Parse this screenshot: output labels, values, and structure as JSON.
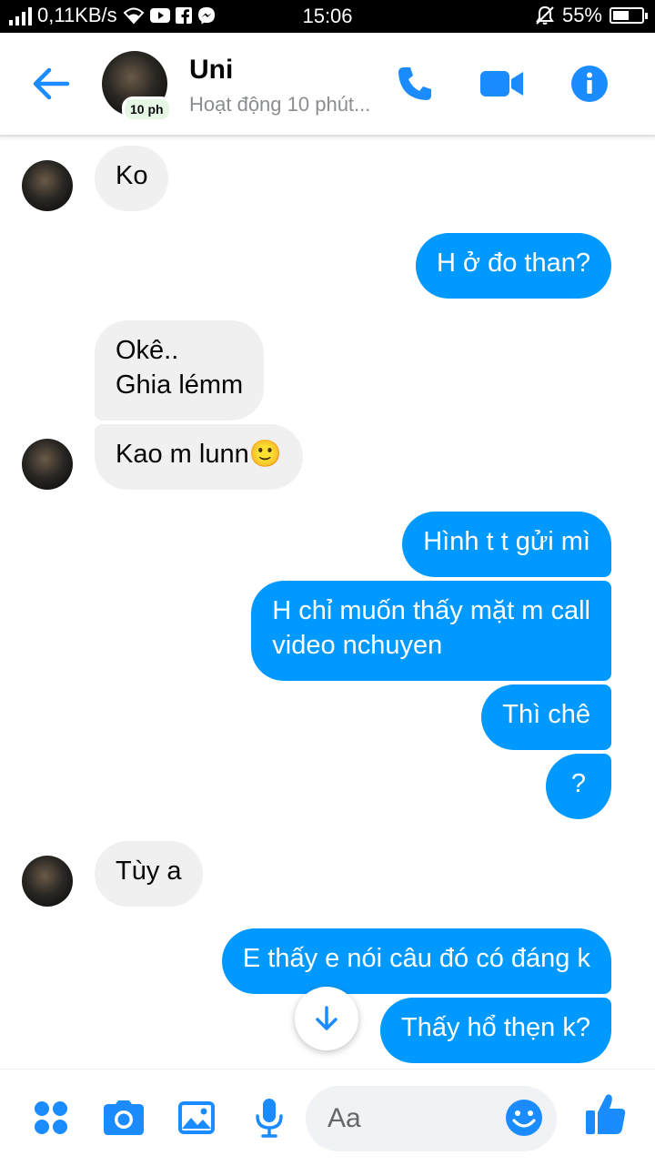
{
  "status_bar": {
    "speed": "0,11KB/s",
    "time": "15:06",
    "battery": "55%",
    "battery_level": 0.55
  },
  "header": {
    "name": "Uni",
    "status": "Hoạt động 10 phút...",
    "active_badge": "10 ph"
  },
  "messages": [
    {
      "side": "in",
      "text": "Ko"
    },
    {
      "side": "out",
      "text": "H ở đo than?"
    },
    {
      "side": "in",
      "text": "Okê..\nGhia lémm"
    },
    {
      "side": "in",
      "text": "Kao m lunn🙂"
    },
    {
      "side": "out",
      "text": "Hình t t gửi mì"
    },
    {
      "side": "out",
      "text": "H chỉ muốn thấy mặt m call\nvideo nchuyen"
    },
    {
      "side": "out",
      "text": "Thì chê"
    },
    {
      "side": "out",
      "text": "?"
    },
    {
      "side": "in",
      "text": "Tùy a"
    },
    {
      "side": "out",
      "text": "E thấy e nói câu đó có đáng k"
    },
    {
      "side": "out",
      "text": "Thấy hổ thẹn k?"
    }
  ],
  "composer": {
    "placeholder": "Aa"
  },
  "colors": {
    "accent": "#0099ff",
    "incoming_bubble": "#f1f0f0",
    "icon_blue": "#1a8cff"
  }
}
